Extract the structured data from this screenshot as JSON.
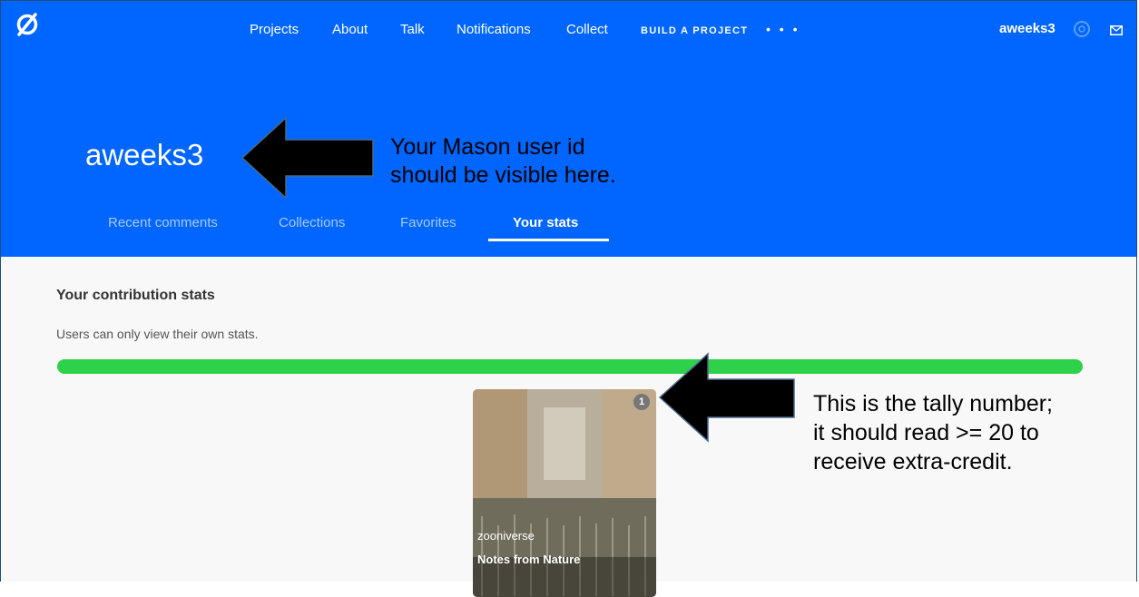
{
  "nav": {
    "items": [
      {
        "label": "Projects"
      },
      {
        "label": "About"
      },
      {
        "label": "Talk"
      },
      {
        "label": "Notifications"
      },
      {
        "label": "Collect"
      },
      {
        "label": "BUILD A PROJECT"
      }
    ],
    "more_label": "• • •",
    "username": "aweeks3"
  },
  "profile": {
    "name": "aweeks3",
    "tabs": [
      {
        "label": "Recent comments"
      },
      {
        "label": "Collections"
      },
      {
        "label": "Favorites"
      },
      {
        "label": "Your stats",
        "selected": true
      }
    ]
  },
  "stats": {
    "heading": "Your contribution stats",
    "note": "Users can only view their own stats."
  },
  "project_card": {
    "owner": "zooniverse",
    "title": "Notes from Nature",
    "count": "1"
  },
  "annotations": {
    "note1_line1": "Your Mason user id",
    "note1_line2": "should be visible here.",
    "note2_line1": "This is the tally number;",
    "note2_line2": "it should read >= 20 to",
    "note2_line3": "receive extra-credit."
  },
  "colors": {
    "header_blue": "#0066ff",
    "progress_green": "#2ed14a",
    "content_bg": "#f8f8f8"
  },
  "icons": [
    "zooniverse-logo-icon",
    "notifications-icon",
    "mail-icon"
  ]
}
